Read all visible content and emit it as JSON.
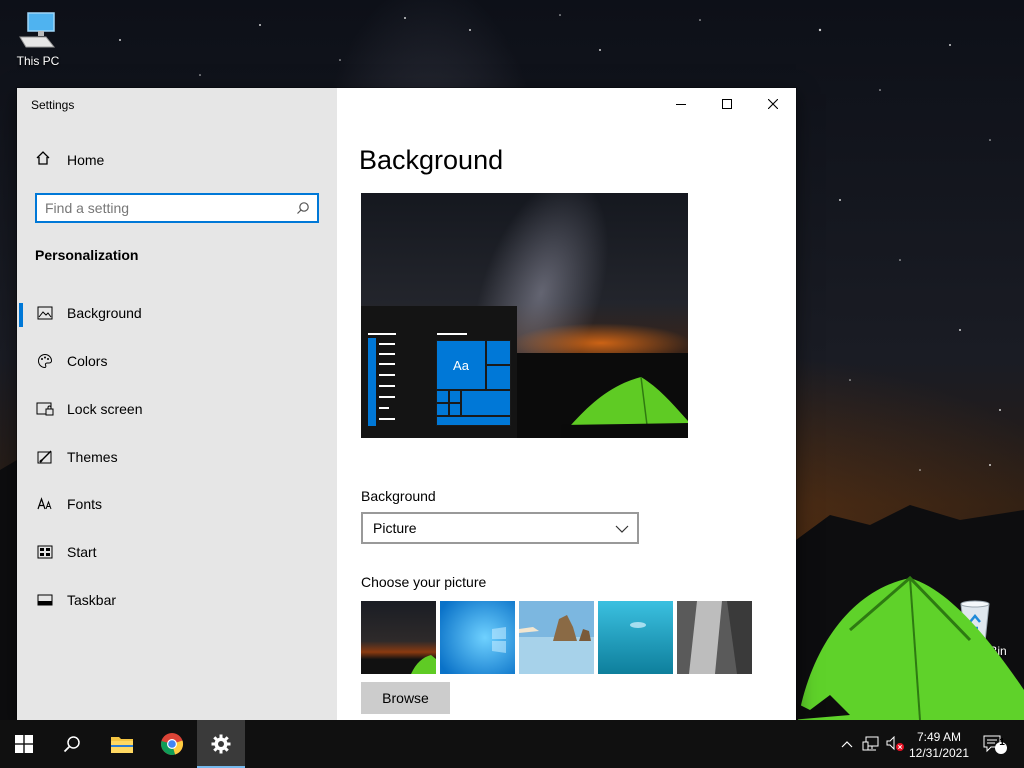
{
  "desktop": {
    "icons": [
      {
        "label": "This PC",
        "icon": "computer-icon"
      },
      {
        "label": "Recycle Bin",
        "icon": "recycle-bin-icon"
      }
    ]
  },
  "window": {
    "title": "Settings",
    "controls": [
      "minimize",
      "maximize",
      "close"
    ]
  },
  "sidebar": {
    "home_label": "Home",
    "search_placeholder": "Find a setting",
    "section_label": "Personalization",
    "items": [
      {
        "label": "Background",
        "icon": "picture-icon",
        "active": true
      },
      {
        "label": "Colors",
        "icon": "palette-icon",
        "active": false
      },
      {
        "label": "Lock screen",
        "icon": "lock-screen-icon",
        "active": false
      },
      {
        "label": "Themes",
        "icon": "themes-icon",
        "active": false
      },
      {
        "label": "Fonts",
        "icon": "fonts-icon",
        "active": false
      },
      {
        "label": "Start",
        "icon": "start-icon",
        "active": false
      },
      {
        "label": "Taskbar",
        "icon": "taskbar-icon",
        "active": false
      }
    ]
  },
  "main": {
    "page_title": "Background",
    "preview_tile_text": "Aa",
    "background_label": "Background",
    "background_value": "Picture",
    "choose_label": "Choose your picture",
    "browse_label": "Browse"
  },
  "taskbar": {
    "time": "7:49 AM",
    "date": "12/31/2021",
    "notification_count": "1",
    "pinned": [
      "start-button",
      "search-button",
      "file-explorer",
      "chrome",
      "settings"
    ]
  },
  "colors": {
    "accent": "#0078d7",
    "sidebar_bg": "#e6e6e6",
    "taskbar_bg": "#101010"
  }
}
